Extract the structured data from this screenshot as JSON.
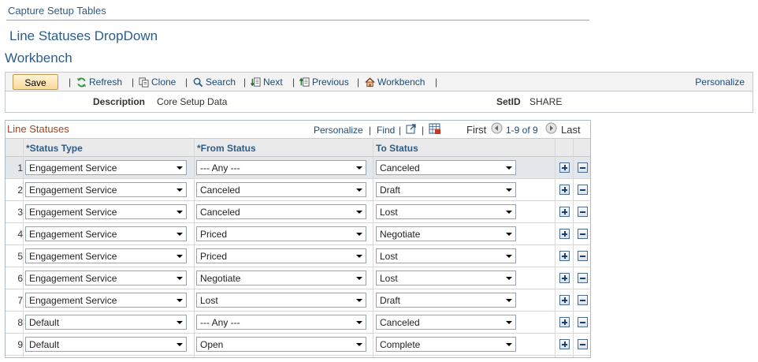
{
  "breadcrumb": "Capture Setup Tables",
  "page_title": "Line Statuses DropDown",
  "page_subtitle": "Workbench",
  "toolbar": {
    "save": "Save",
    "refresh": "Refresh",
    "clone": "Clone",
    "search": "Search",
    "next": "Next",
    "previous": "Previous",
    "workbench": "Workbench",
    "personalize": "Personalize",
    "sep": "|"
  },
  "header": {
    "description_label": "Description",
    "description_value": "Core Setup Data",
    "setid_label": "SetID",
    "setid_value": "SHARE"
  },
  "grid": {
    "title": "Line Statuses",
    "personalize": "Personalize",
    "find": "Find",
    "sep": "|",
    "first": "First",
    "range": "1-9 of 9",
    "last": "Last",
    "columns": {
      "status_type": "*Status Type",
      "from_status": "*From Status",
      "to_status": "To Status"
    },
    "rows": [
      {
        "num": "1",
        "status_type": "Engagement Service",
        "from_status": "--- Any ---",
        "to_status": "Canceled"
      },
      {
        "num": "2",
        "status_type": "Engagement Service",
        "from_status": "Canceled",
        "to_status": "Draft"
      },
      {
        "num": "3",
        "status_type": "Engagement Service",
        "from_status": "Canceled",
        "to_status": "Lost"
      },
      {
        "num": "4",
        "status_type": "Engagement Service",
        "from_status": "Priced",
        "to_status": "Negotiate"
      },
      {
        "num": "5",
        "status_type": "Engagement Service",
        "from_status": "Priced",
        "to_status": "Lost"
      },
      {
        "num": "6",
        "status_type": "Engagement Service",
        "from_status": "Negotiate",
        "to_status": "Lost"
      },
      {
        "num": "7",
        "status_type": "Engagement Service",
        "from_status": "Lost",
        "to_status": "Draft"
      },
      {
        "num": "8",
        "status_type": "Default",
        "from_status": "--- Any ---",
        "to_status": "Canceled"
      },
      {
        "num": "9",
        "status_type": "Default",
        "from_status": "Open",
        "to_status": "Complete"
      }
    ]
  }
}
